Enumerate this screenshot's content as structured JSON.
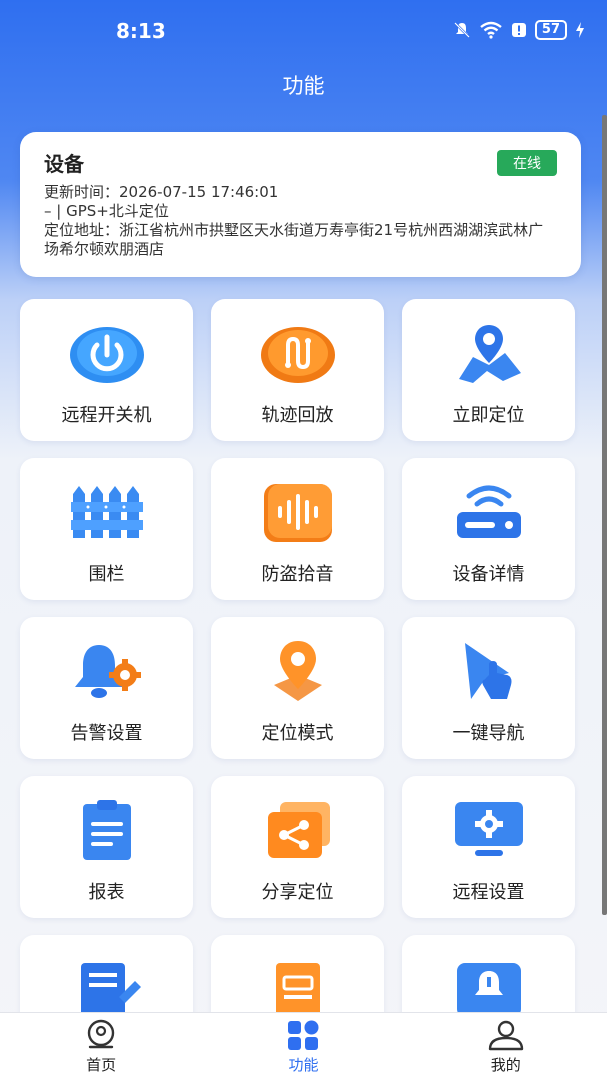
{
  "status": {
    "time": "8:13",
    "battery": "57"
  },
  "header": {
    "title": "功能"
  },
  "device": {
    "name": "设备",
    "status": "在线",
    "update_time": "更新时间：2026-07-15 17:46:01",
    "positioning": "– | GPS+北斗定位",
    "address": "定位地址：浙江省杭州市拱墅区天水街道万寿亭街21号杭州西湖湖滨武林广场希尔顿欢朋酒店"
  },
  "functions": [
    {
      "label": "远程开关机",
      "icon": "power-icon"
    },
    {
      "label": "轨迹回放",
      "icon": "track-icon"
    },
    {
      "label": "立即定位",
      "icon": "map-pin-icon"
    },
    {
      "label": "围栏",
      "icon": "fence-icon"
    },
    {
      "label": "防盗拾音",
      "icon": "sound-wave-icon"
    },
    {
      "label": "设备详情",
      "icon": "router-icon"
    },
    {
      "label": "告警设置",
      "icon": "bell-gear-icon"
    },
    {
      "label": "定位模式",
      "icon": "location-mode-icon"
    },
    {
      "label": "一键导航",
      "icon": "navigation-icon"
    },
    {
      "label": "报表",
      "icon": "clipboard-icon"
    },
    {
      "label": "分享定位",
      "icon": "share-icon"
    },
    {
      "label": "远程设置",
      "icon": "monitor-gear-icon"
    },
    {
      "label": "",
      "icon": "edit-document-icon"
    },
    {
      "label": "",
      "icon": "file-card-icon"
    },
    {
      "label": "",
      "icon": "alert-monitor-icon"
    }
  ],
  "tabs": [
    {
      "label": "首页",
      "icon": "home-location-icon",
      "active": false
    },
    {
      "label": "功能",
      "icon": "grid-apps-icon",
      "active": true
    },
    {
      "label": "我的",
      "icon": "profile-icon",
      "active": false
    }
  ],
  "colors": {
    "primary": "#2f6ff0",
    "online": "#27a95a",
    "orange": "#f78a1d"
  }
}
